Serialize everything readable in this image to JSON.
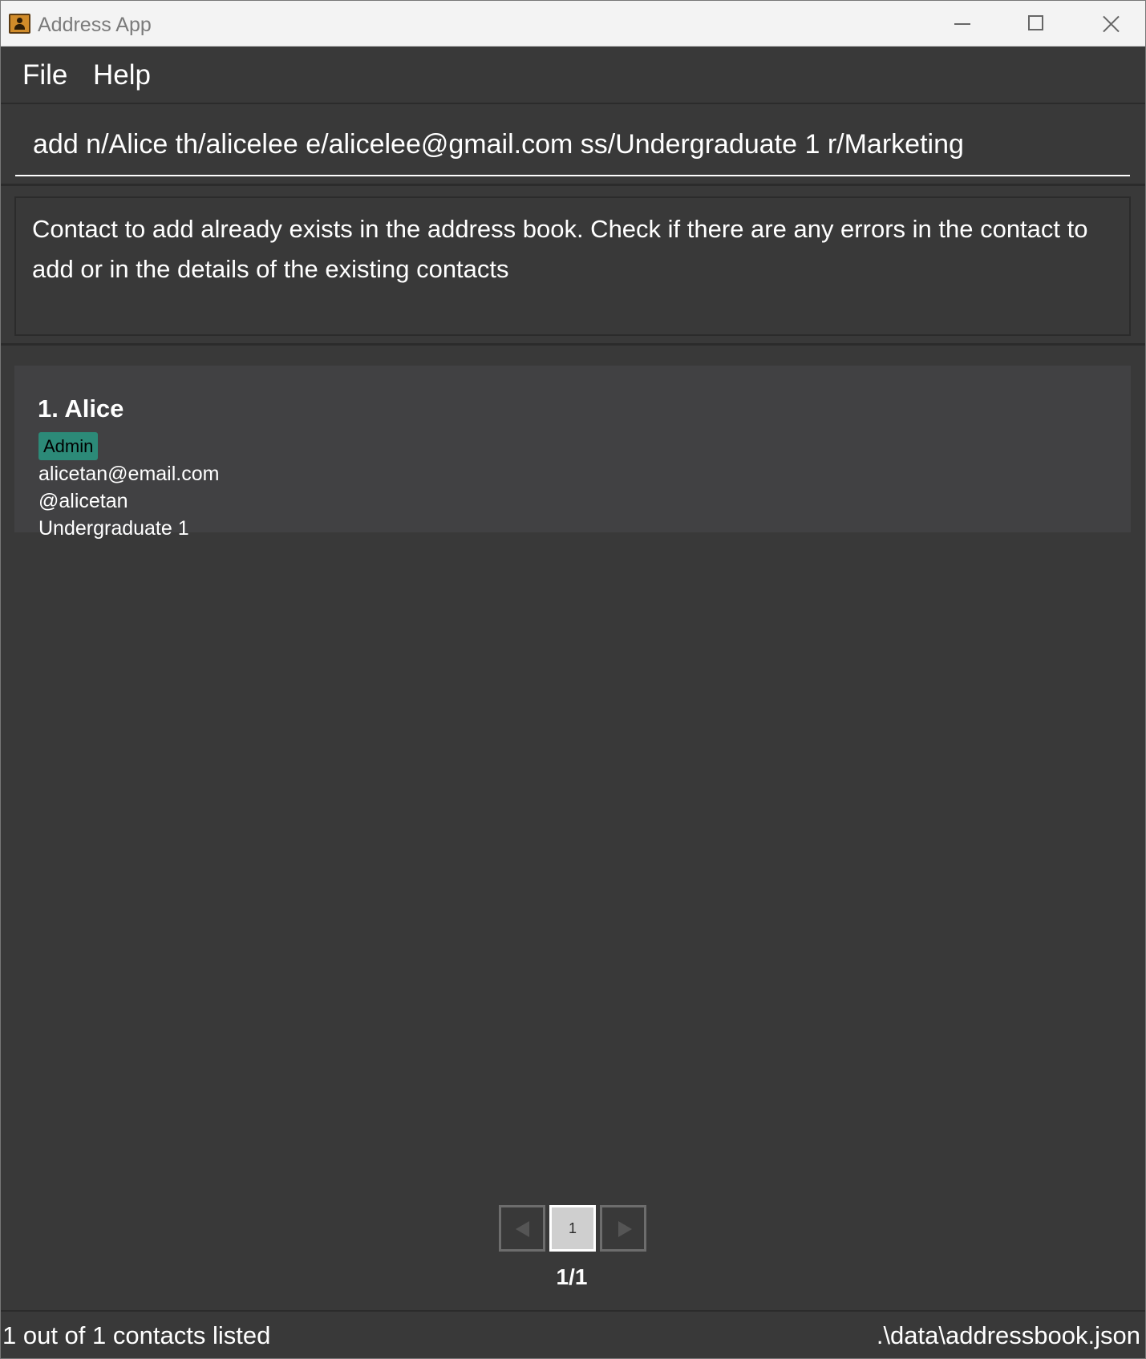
{
  "window": {
    "title": "Address App",
    "app_icon": "address-book-icon"
  },
  "menu": {
    "items": [
      {
        "label": "File"
      },
      {
        "label": "Help"
      }
    ]
  },
  "command": {
    "value": "add n/Alice th/alicelee e/alicelee@gmail.com ss/Undergraduate 1 r/Marketing"
  },
  "result": {
    "message": "Contact to add already exists in the address book. Check if there are any errors in the contact to add or in the details of the existing contacts"
  },
  "persons": [
    {
      "name": "1. Alice",
      "tag": "Admin",
      "email": "alicetan@email.com",
      "telegram": "@alicetan",
      "status": "Undergraduate 1"
    }
  ],
  "pagination": {
    "current_page_button": "1",
    "indicator": "1/1"
  },
  "statusbar": {
    "listed": "1 out of 1 contacts listed",
    "file_path": ".\\data\\addressbook.json"
  },
  "colors": {
    "background": "#393939",
    "card": "#414143",
    "tag": "#2c8a78"
  }
}
